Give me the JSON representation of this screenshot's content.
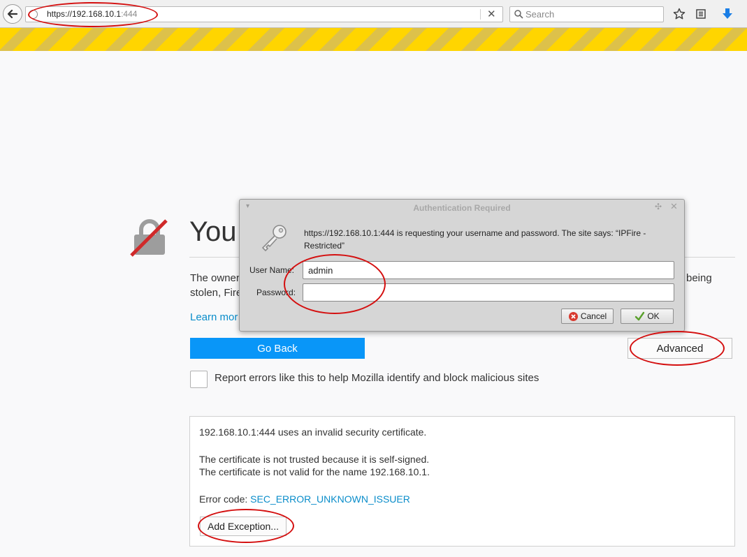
{
  "browser": {
    "url_host": "https://192.168.10.1",
    "url_port": ":444",
    "search_placeholder": "Search"
  },
  "error_page": {
    "title": "You",
    "desc_line1": "The owner",
    "desc_line2": "stolen, Fire",
    "desc_right": "being",
    "learn_more": "Learn mor",
    "go_back": "Go Back",
    "advanced": "Advanced",
    "report_label": "Report errors like this to help Mozilla identify and block malicious sites",
    "advanced_panel": {
      "line1": "192.168.10.1:444 uses an invalid security certificate.",
      "line2": "The certificate is not trusted because it is self-signed.",
      "line3": "The certificate is not valid for the name 192.168.10.1.",
      "error_label": "Error code: ",
      "error_code": "SEC_ERROR_UNKNOWN_ISSUER",
      "add_exception": "Add Exception..."
    }
  },
  "auth_dialog": {
    "title": "Authentication Required",
    "message_line1": "https://192.168.10.1:444 is requesting your username and password. The site says: “IPFire -",
    "message_line2": "Restricted”",
    "username_label": "User Name:",
    "username_value": "admin",
    "password_label": "Password:",
    "password_value": "",
    "cancel_label": "Cancel",
    "ok_label": "OK"
  },
  "colors": {
    "stripe_yellow": "#ffd500",
    "primary_blue": "#0996f8",
    "link_blue": "#0a8dca",
    "annotation_red": "#d40f0f"
  }
}
